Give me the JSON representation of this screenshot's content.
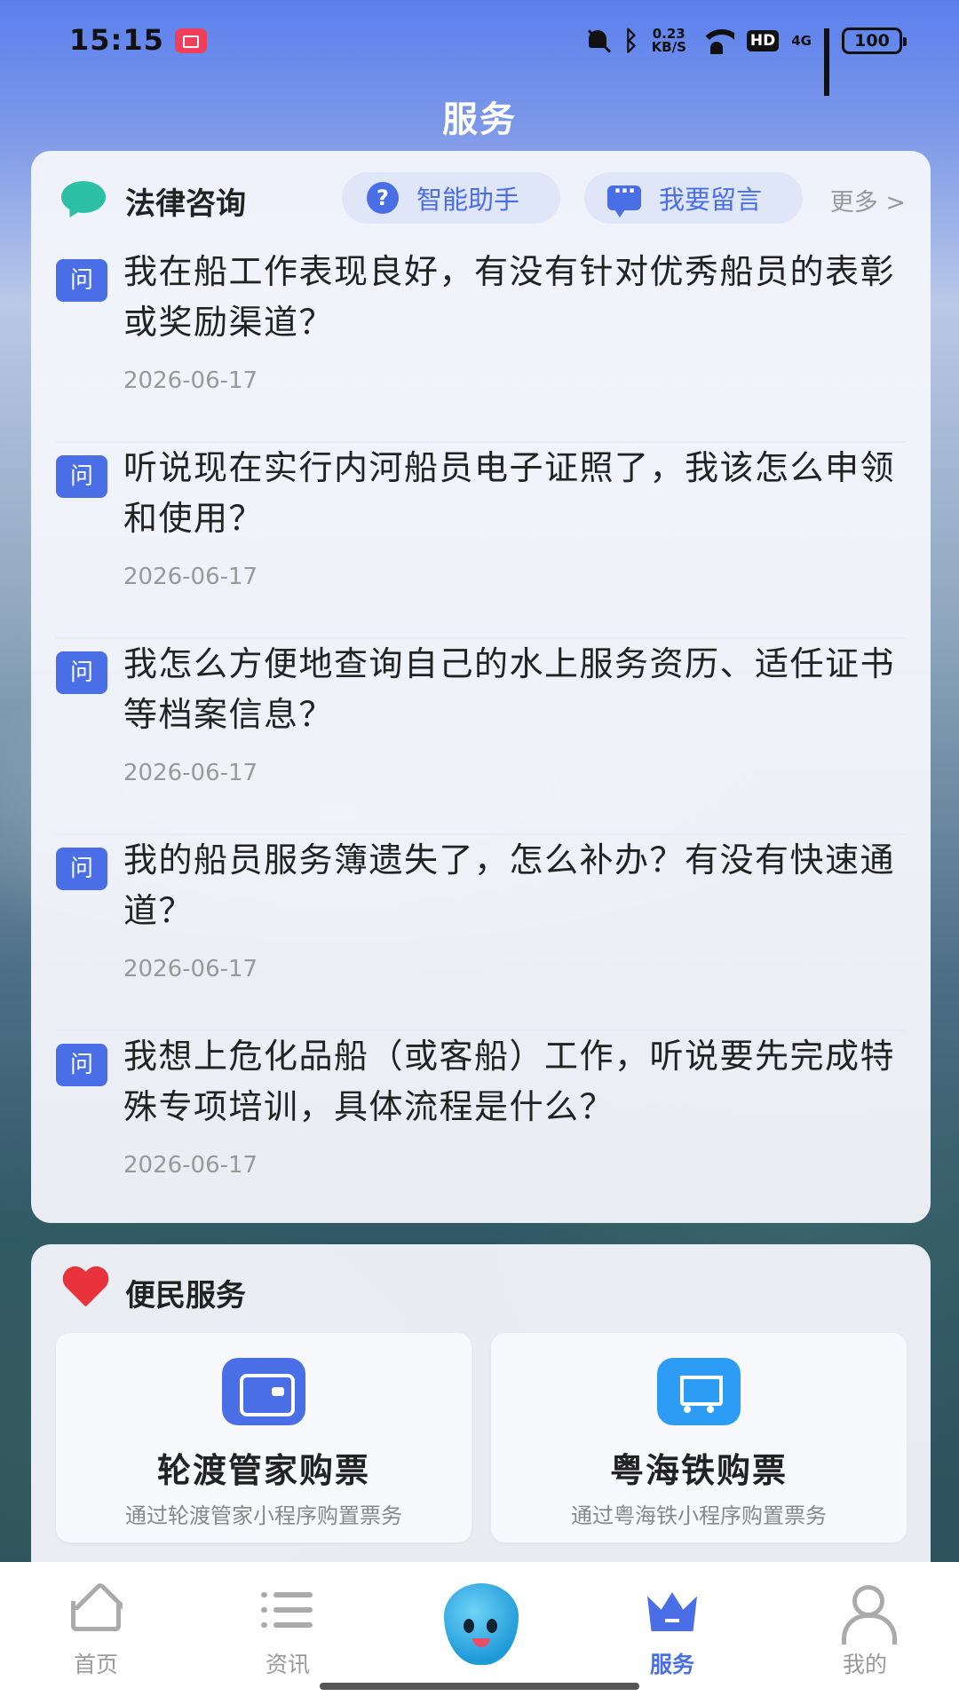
{
  "status_bar": {
    "time": "15:15",
    "net_speed_value": "0.23",
    "net_speed_unit": "KB/S",
    "hd": "HD",
    "network": "4G",
    "battery": "100"
  },
  "page_title": "服务",
  "legal": {
    "title": "法律咨询",
    "assistant_label": "智能助手",
    "message_label": "我要留言",
    "more_label": "更多 >",
    "badge_text": "问",
    "items": [
      {
        "question": "我在船工作表现良好，有没有针对优秀船员的表彰或奖励渠道？",
        "date": "2026-06-17"
      },
      {
        "question": "听说现在实行内河船员电子证照了，我该怎么申领和使用？",
        "date": "2026-06-17"
      },
      {
        "question": "我怎么方便地查询自己的水上服务资历、适任证书等档案信息？",
        "date": "2026-06-17"
      },
      {
        "question": "我的船员服务簿遗失了，怎么补办？有没有快速通道？",
        "date": "2026-06-17"
      },
      {
        "question": "我想上危化品船（或客船）工作，听说要先完成特殊专项培训，具体流程是什么？",
        "date": "2026-06-17"
      }
    ]
  },
  "services": {
    "title": "便民服务",
    "tiles": [
      {
        "name": "轮渡管家购票",
        "desc": "通过轮渡管家小程序购置票务",
        "icon": "wallet-icon"
      },
      {
        "name": "粤海铁购票",
        "desc": "通过粤海铁小程序购置票务",
        "icon": "cart-icon"
      }
    ]
  },
  "tabs": {
    "home": "首页",
    "news": "资讯",
    "service": "服务",
    "mine": "我的"
  },
  "colors": {
    "accent": "#4a6ee6",
    "chat": "#2ec0a6",
    "heart": "#e8333c"
  }
}
